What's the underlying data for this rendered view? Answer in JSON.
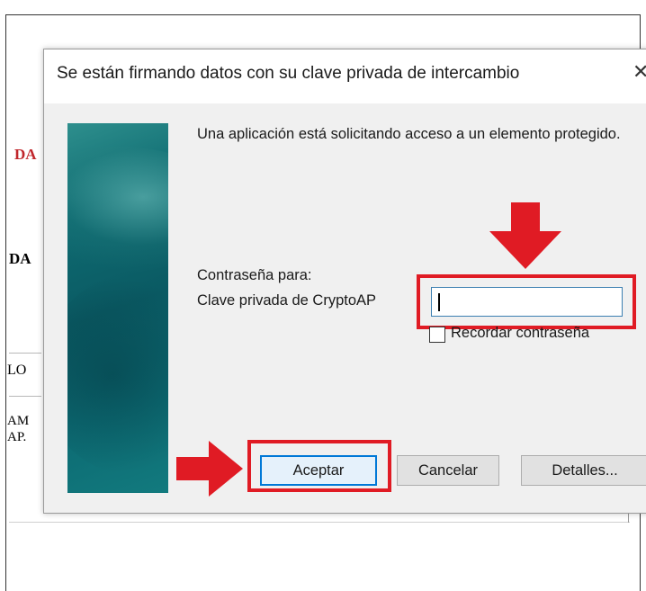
{
  "background": {
    "frag1": "DA",
    "frag2": "DA",
    "frag3": "LO",
    "frag4": "AM",
    "frag5": "AP."
  },
  "dialog": {
    "title": "Se están firmando datos con su clave privada de intercambio",
    "close_glyph": "✕",
    "message": "Una aplicación está solicitando acceso a un elemento protegido.",
    "password_label": "Contraseña para:",
    "key_name": "Clave privada de CryptoAP",
    "password_value": "",
    "remember_label": "Recordar contraseña",
    "remember_checked": false,
    "buttons": {
      "accept": "Aceptar",
      "cancel": "Cancelar",
      "details": "Detalles..."
    }
  },
  "annotations": {
    "highlight_color": "#e01b24",
    "arrow_icon": "red-arrow-icon"
  }
}
